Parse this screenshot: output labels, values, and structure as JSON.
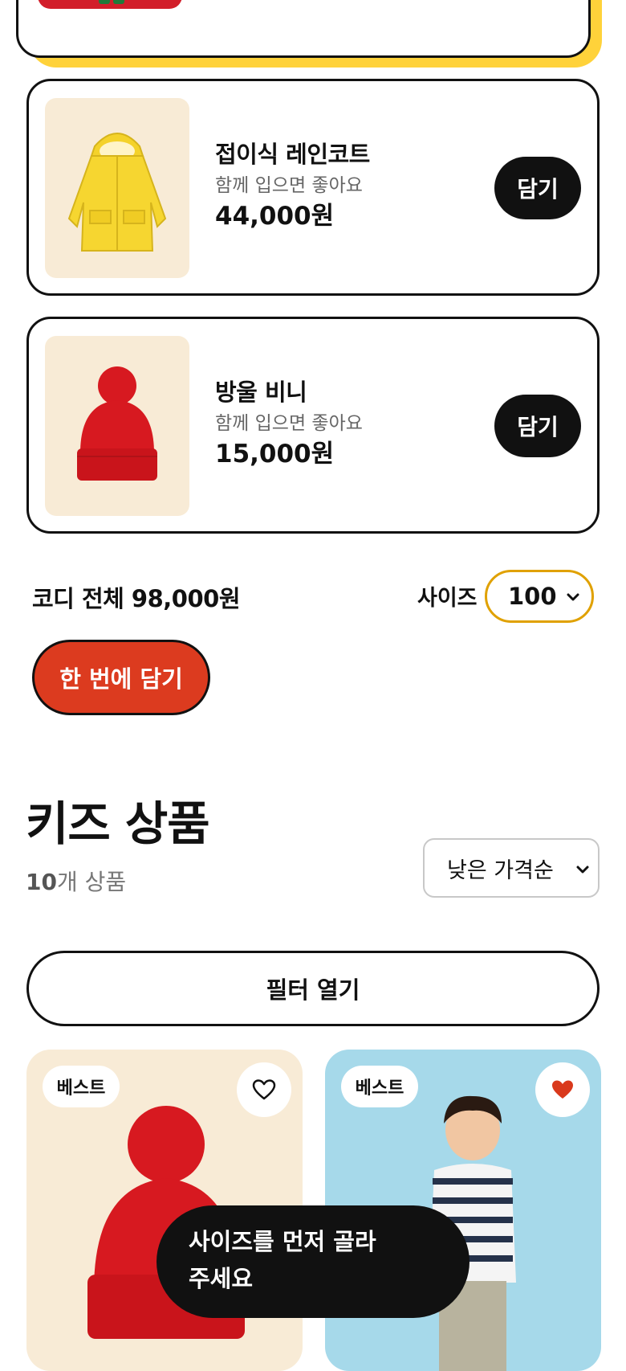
{
  "products": [
    {
      "name": "접이식 레인코트",
      "subtitle": "함께 입으면 좋아요",
      "price": "44,000원",
      "add_label": "담기",
      "image_icon": "yellow-raincoat"
    },
    {
      "name": "방울 비니",
      "subtitle": "함께 입으면 좋아요",
      "price": "15,000원",
      "add_label": "담기",
      "image_icon": "red-beanie"
    }
  ],
  "coordi": {
    "total": "코디 전체 98,000원",
    "size_label": "사이즈",
    "size_value": "100",
    "bundle_label": "한 번에 담기"
  },
  "kids": {
    "title": "키즈 상품",
    "count_number": "10",
    "count_suffix": "개 상품",
    "sort_value": "낮은 가격순",
    "filter_label": "필터 열기",
    "items": [
      {
        "badge": "베스트",
        "favorited": false,
        "image_icon": "red-beanie"
      },
      {
        "badge": "베스트",
        "favorited": true,
        "image_icon": "boy-striped-shirt"
      }
    ]
  },
  "toast": {
    "line1": "사이즈를 먼저 골라",
    "line2": "주세요"
  },
  "colors": {
    "accent_yellow": "#ffd23a",
    "cta_red": "#dc3b1f",
    "size_border": "#e0a100",
    "heart_red": "#d9391c",
    "card_beige": "#f8ebd6",
    "card_blue": "#a6d9ea"
  }
}
